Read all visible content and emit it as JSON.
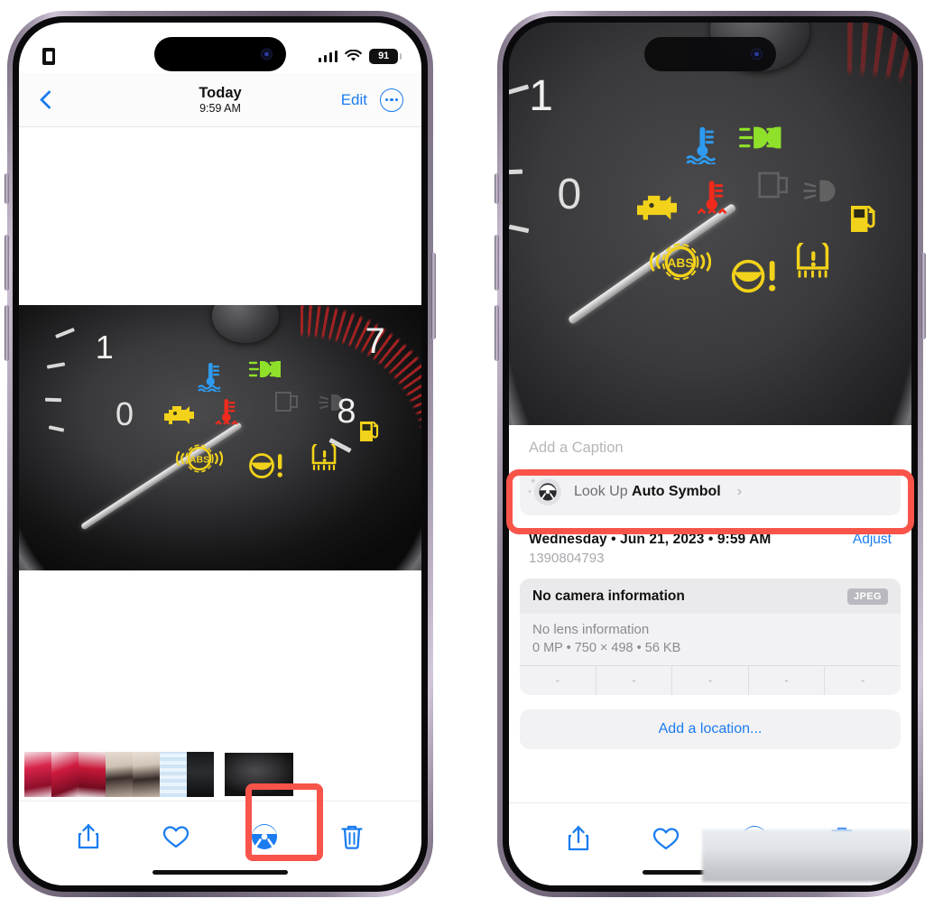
{
  "meta": {
    "accent_blue": "#1A7CF0",
    "highlight_red": "#F8544A",
    "sheet_gray": "#F2F2F4"
  },
  "left_phone": {
    "status_bar": {
      "sim_icon": "sim-card-icon",
      "signal_icon": "cellular-bars-icon",
      "wifi_icon": "wifi-icon",
      "battery_level": "91"
    },
    "nav": {
      "back_icon": "chevron-left-icon",
      "title": "Today",
      "subtitle": "9:59 AM",
      "edit_label": "Edit",
      "more_icon": "ellipsis-circle-icon"
    },
    "photo": {
      "alt_name": "car-dashboard-warning-lights-photo"
    },
    "filmstrip": {
      "thumbnails": [
        {
          "name": "thumbnail-roses-1"
        },
        {
          "name": "thumbnail-roses-2"
        },
        {
          "name": "thumbnail-roses-3"
        },
        {
          "name": "thumbnail-person-1"
        },
        {
          "name": "thumbnail-person-2"
        },
        {
          "name": "thumbnail-calendar"
        },
        {
          "name": "thumbnail-device"
        }
      ],
      "selected": {
        "name": "thumbnail-dashboard-selected"
      }
    },
    "toolbar": {
      "share_icon": "share-icon",
      "favorite_icon": "heart-icon",
      "lookup_icon": "steering-wheel-icon",
      "delete_icon": "trash-icon"
    },
    "highlight": {
      "target": "steering-wheel-toolbar-button"
    }
  },
  "right_phone": {
    "status_bar": {
      "dynamic_island": "dynamic-island"
    },
    "photo": {
      "alt_name": "car-dashboard-warning-lights-photo-zoomed"
    },
    "detail": {
      "caption_placeholder": "Add a Caption",
      "lookup": {
        "icon": "steering-wheel-icon",
        "prefix": "Look Up ",
        "subject": "Auto Symbol",
        "chevron": "chevron-right-icon"
      },
      "date_line": "Wednesday • Jun 21, 2023 • 9:59 AM",
      "adjust_label": "Adjust",
      "asset_id": "1390804793",
      "exif": {
        "camera": "No camera information",
        "format_badge": "JPEG",
        "lens": "No lens information",
        "specs": "0 MP • 750 × 498 • 56 KB",
        "cells": [
          "-",
          "-",
          "-",
          "-",
          "-"
        ]
      },
      "add_location_label": "Add a location..."
    },
    "toolbar": {
      "share_icon": "share-icon",
      "favorite_icon": "heart-icon",
      "lookup_icon": "steering-wheel-icon",
      "delete_icon": "trash-icon"
    },
    "highlight": {
      "target": "look-up-auto-symbol-row"
    }
  },
  "dashboard_photo": {
    "gauge_numbers": [
      "1",
      "0",
      "7",
      "8"
    ],
    "warning_lamps": [
      {
        "name": "coolant-temperature-low-lamp",
        "color": "#2E9BF0"
      },
      {
        "name": "high-beam-lamp",
        "color": "#8FE02A"
      },
      {
        "name": "check-engine-lamp",
        "color": "#F2D21A"
      },
      {
        "name": "engine-overheat-lamp",
        "color": "#EE2B1C"
      },
      {
        "name": "abs-lamp",
        "color": "#F2D21A"
      },
      {
        "name": "power-steering-lamp",
        "color": "#F2D21A"
      },
      {
        "name": "tire-pressure-lamp",
        "color": "#F2D21A"
      },
      {
        "name": "low-fuel-lamp",
        "color": "#F2D21A"
      },
      {
        "name": "door-ajar-lamp-off",
        "color": "#5A5A5C"
      },
      {
        "name": "low-beam-lamp-off",
        "color": "#5A5A5C"
      }
    ]
  }
}
